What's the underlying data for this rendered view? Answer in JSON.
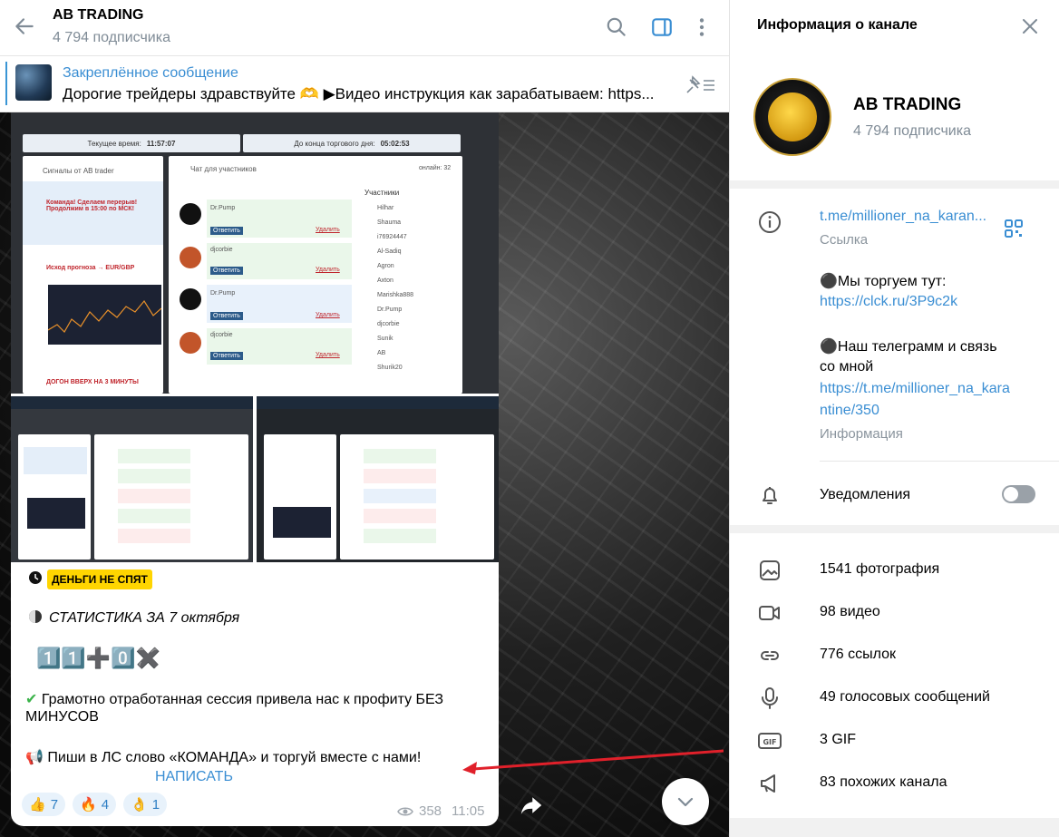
{
  "chat": {
    "title": "AB TRADING",
    "subscribers": "4 794 подписчика",
    "pinned_title": "Закреплённое сообщение",
    "pinned_text": "Дорогие трейдеры здравствуйте 🫶 ▶Видео инструкция как зарабатываем: https..."
  },
  "screenshot": {
    "time_label": "Текущее время:",
    "time_value": "11:57:07",
    "end_label": "До конца торгового дня:",
    "end_value": "05:02:53",
    "signals_title": "Сигналы от AB trader",
    "chat_title": "Чат для участников",
    "online": "онлайн: 32",
    "participants_title": "Участники",
    "participants": [
      "Hilhar",
      "Shauma",
      "i76924447",
      "Al-Sadiq",
      "Agron",
      "Axton",
      "Marishka888",
      "Dr.Pump",
      "djcorbie",
      "Sunik",
      "AB",
      "Shurik20"
    ],
    "signal1": "Команда! Сделаем перерыв! Продолжим в 15:00 по МСК!",
    "signal2": "Исход прогноза → EUR/GBP",
    "signal3": "ДОГОН ВВЕРХ НА 3 МИНУТЫ",
    "users": [
      "Dr.Pump",
      "djcorbie",
      "Dr.Pump",
      "djcorbie"
    ],
    "reply": "Ответить",
    "delete": "Удалить"
  },
  "message": {
    "badge": "ДЕНЬГИ НЕ СПЯТ",
    "stats": "СТАТИСТИКА ЗА 7 октября",
    "score": "1️⃣1️⃣➕0️⃣✖️",
    "line1": "Грамотно отработанная сессия привела нас к профиту БЕЗ",
    "line2": "МИНУСОВ",
    "line3": "Пиши в ЛС слово «КОМАНДА» и торгуй вместе с нами!",
    "write": "НАПИСАТЬ",
    "reactions": [
      {
        "emoji": "👍",
        "count": "7"
      },
      {
        "emoji": "🔥",
        "count": "4"
      },
      {
        "emoji": "👌",
        "count": "1"
      }
    ],
    "views": "358",
    "time": "11:05"
  },
  "info": {
    "header": "Информация о канале",
    "name": "AB TRADING",
    "subscribers": "4 794 подписчика",
    "link": "t.me/millioner_na_karan...",
    "link_label": "Ссылка",
    "desc1": "⚫Мы торгуем тут:",
    "desc2": "https://clck.ru/3P9c2k",
    "desc3": "⚫Наш телеграмм и связь",
    "desc4": "со мной",
    "desc5": "https://t.me/millioner_na_kara",
    "desc6": "ntine/350",
    "desc_label": "Информация",
    "notifications": "Уведомления",
    "media": [
      {
        "icon": "photo-icon",
        "label": "1541 фотография"
      },
      {
        "icon": "video-icon",
        "label": "98 видео"
      },
      {
        "icon": "link-icon",
        "label": "776 ссылок"
      },
      {
        "icon": "microphone-icon",
        "label": "49 голосовых сообщений"
      },
      {
        "icon": "gif-icon",
        "label": "3 GIF"
      },
      {
        "icon": "megaphone-icon",
        "label": "83 похожих канала"
      }
    ]
  },
  "colors": {
    "accent": "#3a8ed3",
    "badge": "#ffd500",
    "annotation_arrow": "#e0202a"
  }
}
